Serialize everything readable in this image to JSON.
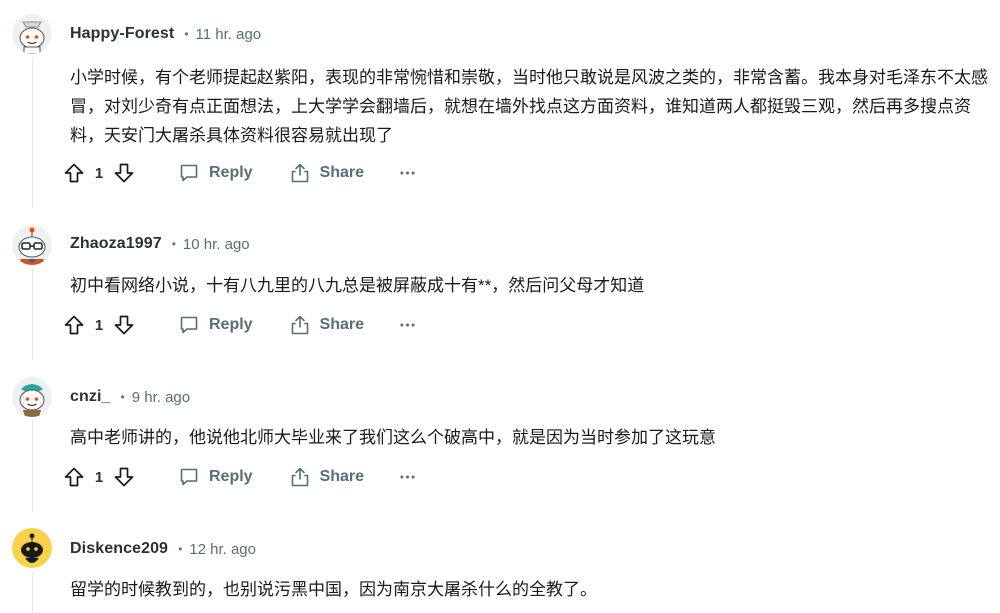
{
  "comments": [
    {
      "author": "Happy-Forest",
      "separator": "•",
      "time": "11 hr. ago",
      "body": "小学时候，有个老师提起赵紫阳，表现的非常惋惜和崇敬，当时他只敢说是风波之类的，非常含蓄。我本身对毛泽东不太感冒，对刘少奇有点正面想法，上大学学会翻墙后，就想在墙外找点这方面资料，谁知道两人都挺毁三观，然后再多搜点资料，天安门大屠杀具体资料很容易就出现了",
      "score": "1",
      "reply_label": "Reply",
      "share_label": "Share",
      "avatar_icon": "snoo-avatar-icon"
    },
    {
      "author": "Zhaoza1997",
      "separator": "•",
      "time": "10 hr. ago",
      "body": "初中看网络小说，十有八九里的八九总是被屏蔽成十有**，然后问父母才知道",
      "score": "1",
      "reply_label": "Reply",
      "share_label": "Share",
      "avatar_icon": "snoo-avatar-icon"
    },
    {
      "author": "cnzi_",
      "separator": "•",
      "time": "9 hr. ago",
      "body": "高中老师讲的，他说他北师大毕业来了我们这么个破高中，就是因为当时参加了这玩意",
      "score": "1",
      "reply_label": "Reply",
      "share_label": "Share",
      "avatar_icon": "snoo-avatar-icon"
    },
    {
      "author": "Diskence209",
      "separator": "•",
      "time": "12 hr. ago",
      "body": "留学的时候教到的，也别说污黑中国，因为南京大屠杀什么的全教了。",
      "avatar_icon": "snoo-avatar-icon"
    }
  ],
  "colors": {
    "meta_text": "#576f76",
    "author_text": "#2a3236",
    "thread_line": "#e5e7eb",
    "avatar_yellow": "#f7d24a"
  }
}
